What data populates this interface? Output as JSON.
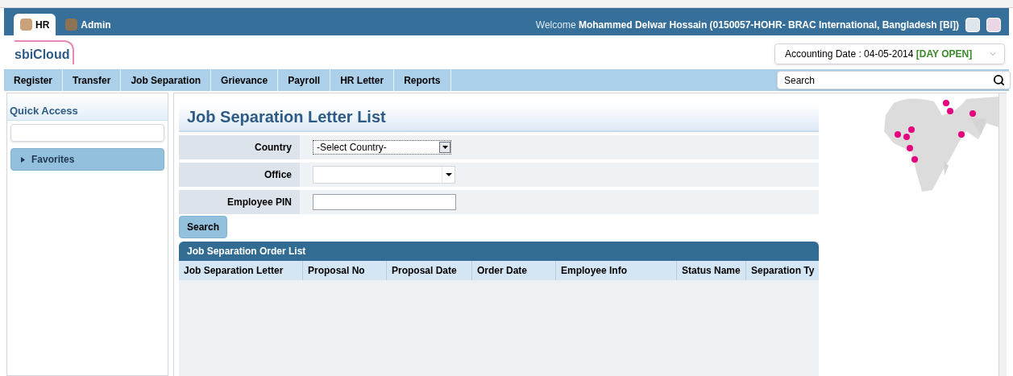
{
  "app_tabs": [
    {
      "label": "HR",
      "selected": true
    },
    {
      "label": "Admin",
      "selected": false
    }
  ],
  "welcome": {
    "prefix": "Welcome",
    "user": "Mohammed Delwar Hossain (0150057-HOHR- BRAC International, Bangladesh [BI])"
  },
  "logo": "sbiCloud",
  "accounting": {
    "label": "Accounting Date : 04-05-2014",
    "status": "[DAY OPEN]"
  },
  "nav": [
    "Register",
    "Transfer",
    "Job Separation",
    "Grievance",
    "Payroll",
    "HR Letter",
    "Reports"
  ],
  "search": {
    "placeholder": "Search"
  },
  "sidebar": {
    "title": "Quick Access",
    "groups": [
      {
        "label": "Favorites",
        "expanded": false
      }
    ]
  },
  "page_title": "Job Separation Letter List",
  "form": [
    {
      "label": "Country",
      "kind": "select",
      "value": "-Select Country-"
    },
    {
      "label": "Office",
      "kind": "combo"
    },
    {
      "label": "Employee PIN",
      "kind": "text"
    }
  ],
  "search_button": "Search",
  "grid": {
    "title": "Job Separation Order List",
    "columns": [
      "Job Separation Letter",
      "Proposal No",
      "Proposal Date",
      "Order Date",
      "Employee Info",
      "Status Name",
      "Separation Ty"
    ]
  }
}
